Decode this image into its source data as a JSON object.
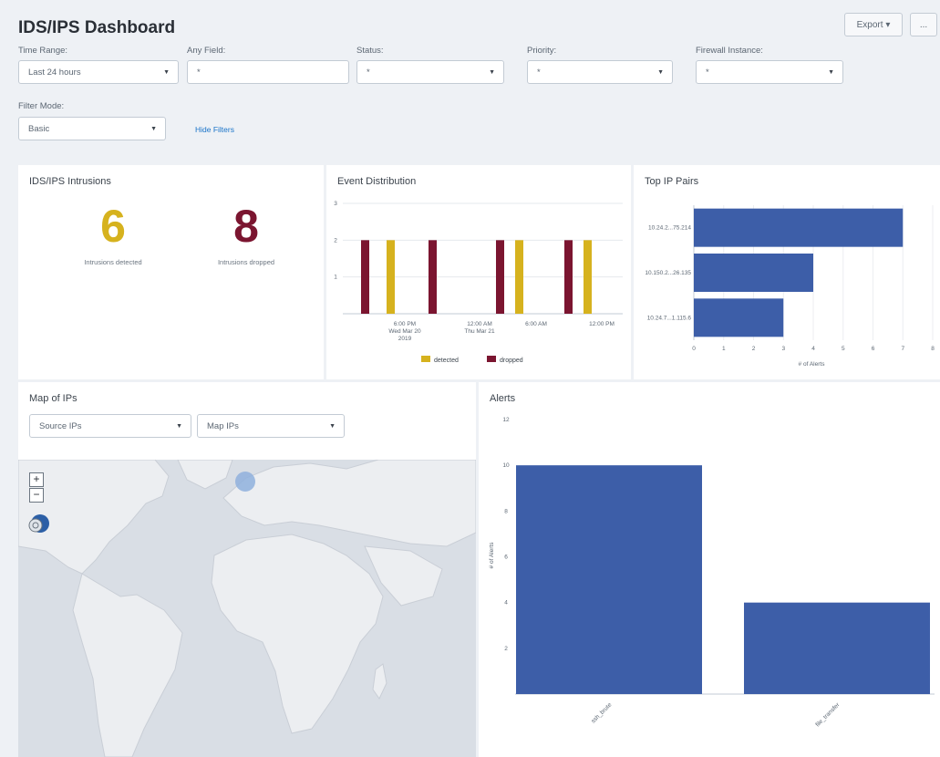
{
  "header": {
    "title": "IDS/IPS Dashboard",
    "export_label": "Export ▾",
    "more_label": "..."
  },
  "filters": [
    {
      "label": "Time Range:",
      "value": "Last 24 hours",
      "type": "select"
    },
    {
      "label": "Any Field:",
      "value": "*",
      "type": "input"
    },
    {
      "label": "Status:",
      "value": "*",
      "type": "select"
    },
    {
      "label": "Priority:",
      "value": "*",
      "type": "select"
    },
    {
      "label": "Firewall Instance:",
      "value": "*",
      "type": "select"
    }
  ],
  "filter_mode": {
    "label": "Filter Mode:",
    "value": "Basic"
  },
  "hide_filters_label": "Hide Filters",
  "intrusions": {
    "title": "IDS/IPS Intrusions",
    "detected_value": "6",
    "detected_label": "Intrusions detected",
    "dropped_value": "8",
    "dropped_label": "Intrusions dropped",
    "detected_color": "#d6b21e",
    "dropped_color": "#7b1530"
  },
  "event_distribution": {
    "title": "Event Distribution",
    "chart_data": {
      "type": "bar",
      "yticks": [
        "1",
        "2",
        "3"
      ],
      "ylim": [
        0,
        3
      ],
      "x_tick_labels": [
        [
          "6:00 PM",
          "Wed Mar 20",
          "2019"
        ],
        [
          "12:00 AM",
          "Thu Mar 21"
        ],
        [
          "6:00 AM"
        ],
        [
          "12:00 PM"
        ]
      ],
      "series": [
        {
          "name": "detected",
          "color": "#d6b21e",
          "values": [
            0,
            2,
            0,
            0,
            2,
            0,
            2
          ]
        },
        {
          "name": "dropped",
          "color": "#7b1530",
          "values": [
            2,
            0,
            2,
            2,
            0,
            2,
            0
          ]
        }
      ]
    }
  },
  "top_ip_pairs": {
    "title": "Top IP Pairs",
    "chart_data": {
      "type": "bar",
      "orientation": "horizontal",
      "categories": [
        "10.24.2...75.214",
        "10.150.2...26.135",
        "10.24.7...1.115.6"
      ],
      "values": [
        7,
        4,
        3
      ],
      "xlim": [
        0,
        8
      ],
      "xticks": [
        "0",
        "1",
        "2",
        "3",
        "4",
        "5",
        "6",
        "7",
        "8"
      ],
      "xlabel": "# of Alerts",
      "color": "#3d5ea8"
    }
  },
  "map_of_ips": {
    "title": "Map of IPs",
    "source_select": "Source IPs",
    "map_select": "Map IPs",
    "zoom_in": "+",
    "zoom_out": "−"
  },
  "alerts": {
    "title": "Alerts",
    "chart_data": {
      "type": "bar",
      "categories": [
        "ssh_brute",
        "file_transfer"
      ],
      "values": [
        10,
        4
      ],
      "ylim": [
        0,
        12
      ],
      "yticks": [
        "2",
        "4",
        "6",
        "8",
        "10",
        "12"
      ],
      "ylabel": "# of Alerts",
      "color": "#3d5ea8"
    }
  }
}
